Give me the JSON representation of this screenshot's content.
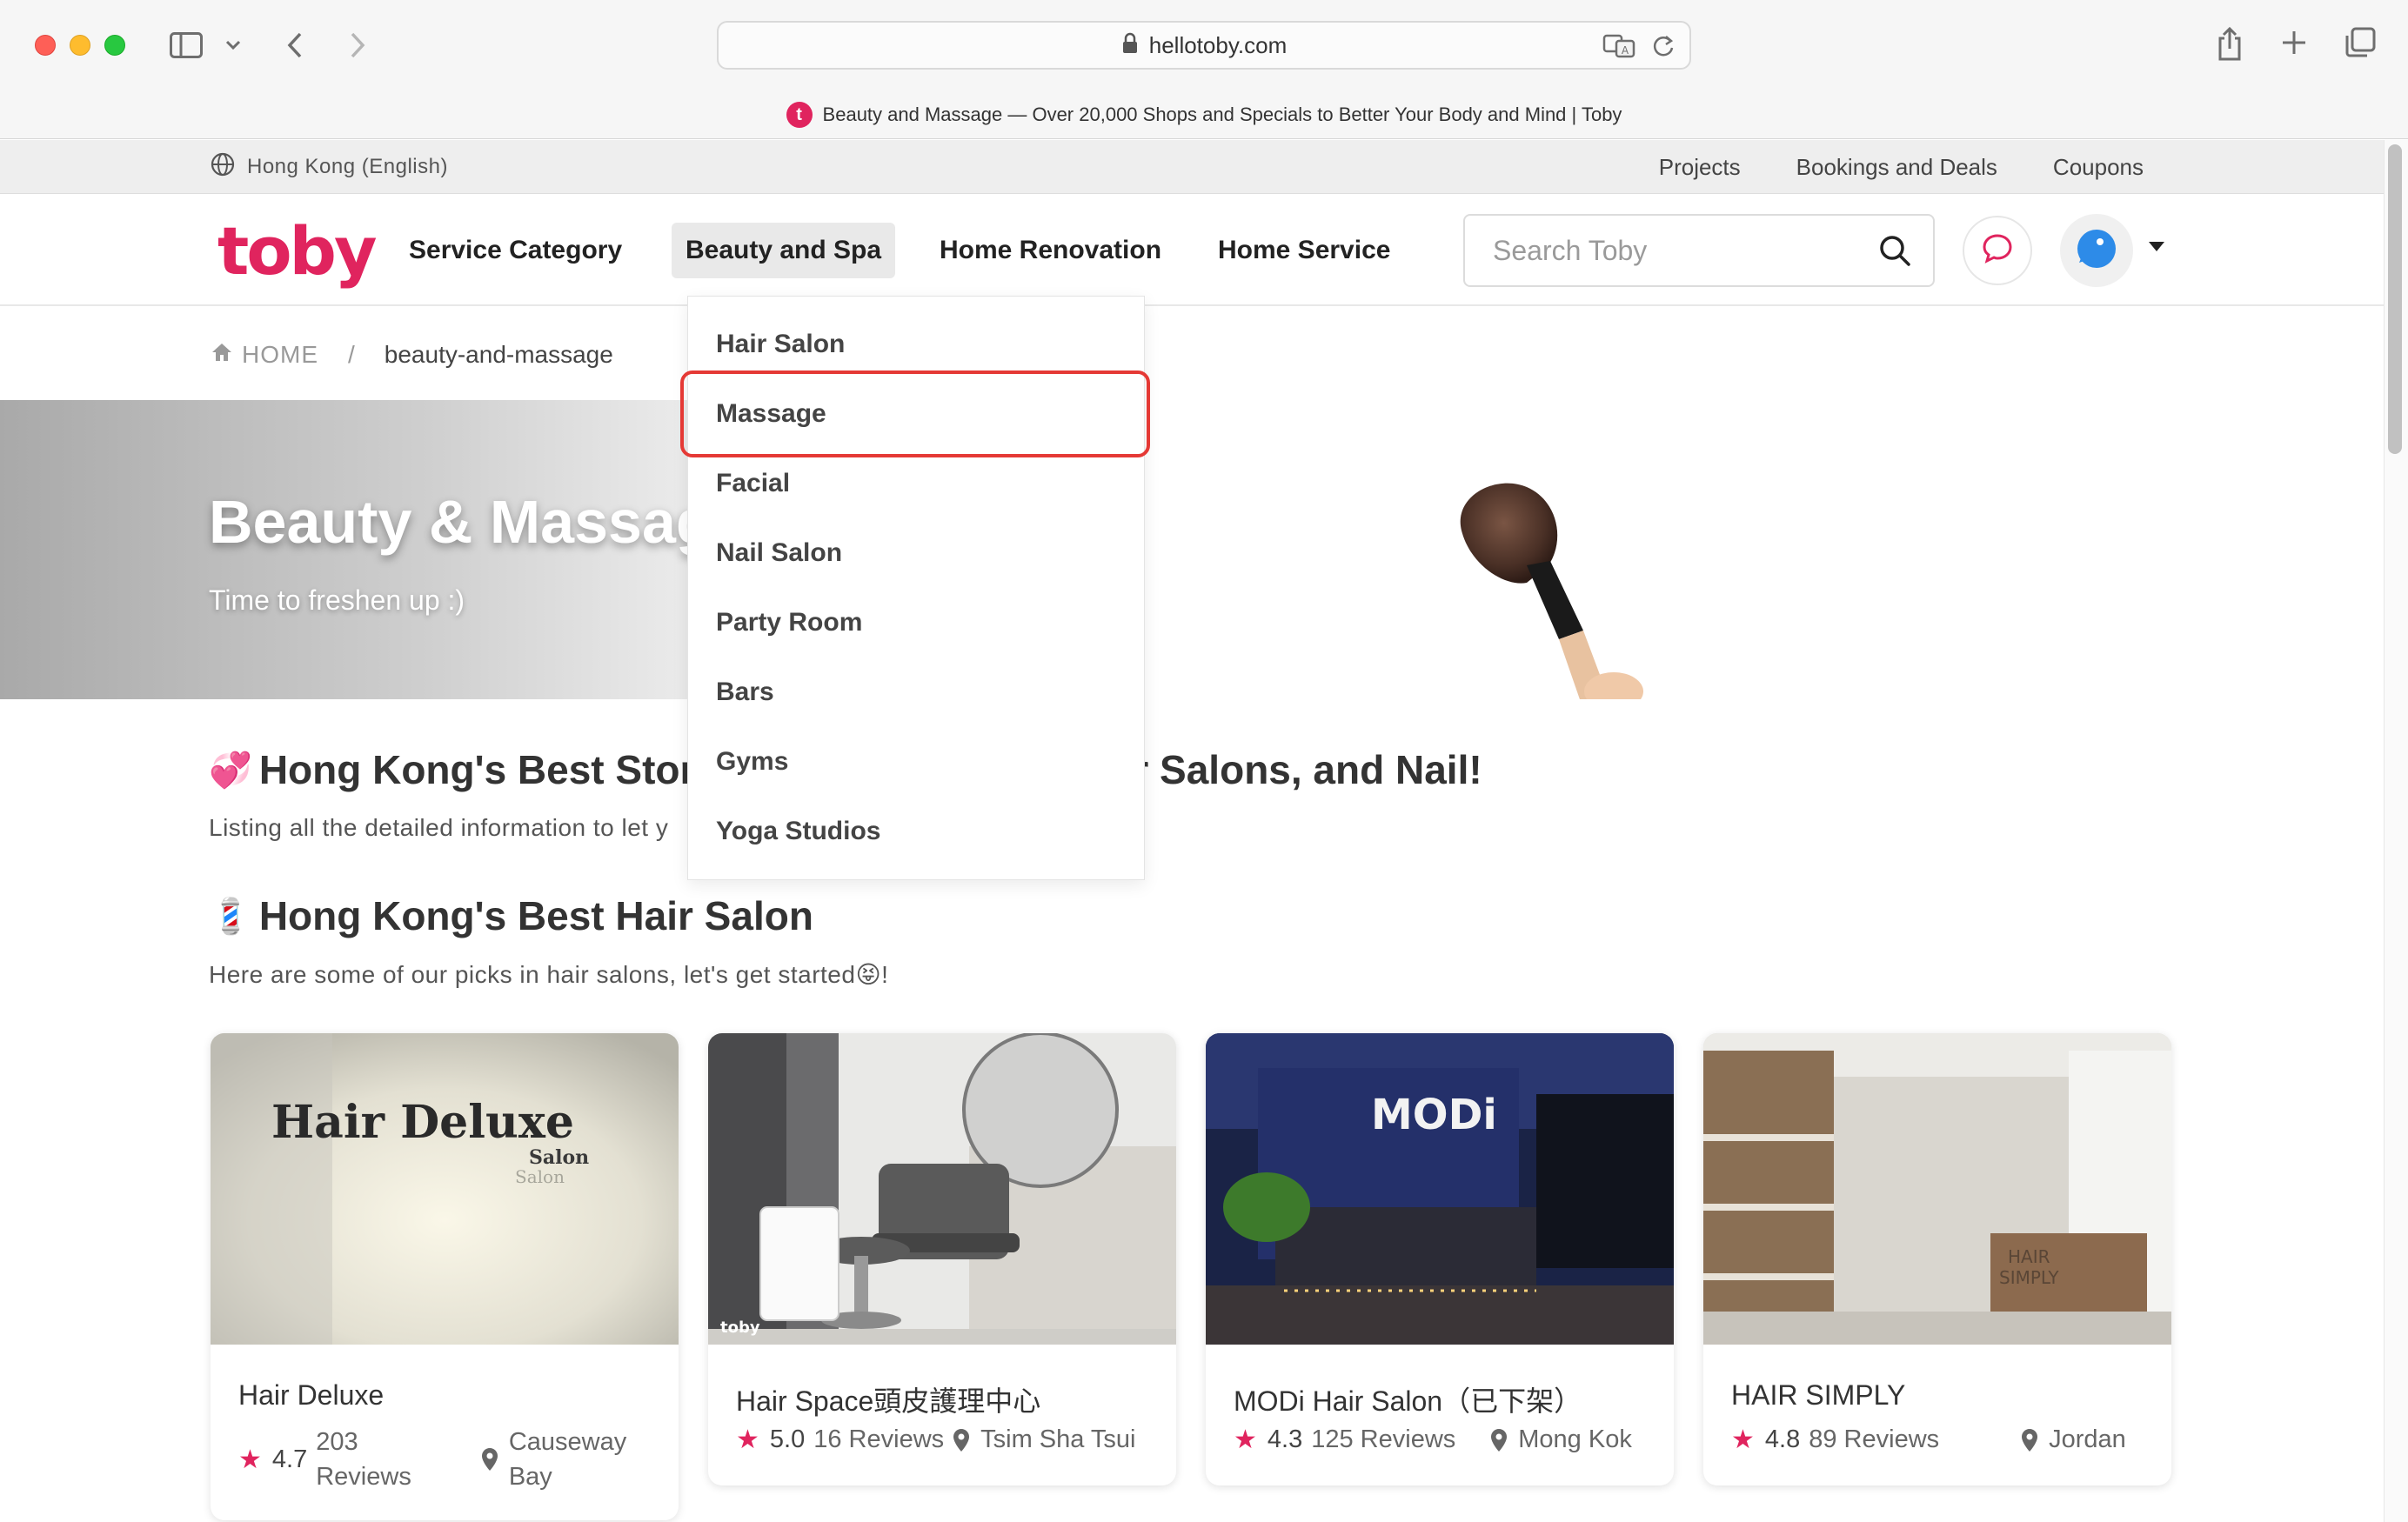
{
  "browser": {
    "url": "hellotoby.com",
    "tab_title": "Beauty and Massage — Over 20,000 Shops and Specials to Better Your Body and Mind | Toby",
    "favicon_letter": "t"
  },
  "utilbar": {
    "region": "Hong Kong (English)",
    "links": [
      "Projects",
      "Bookings and Deals",
      "Coupons"
    ]
  },
  "header": {
    "logo": "toby",
    "nav": [
      "Service Category",
      "Beauty and Spa",
      "Home Renovation",
      "Home Service"
    ],
    "active_nav": "Beauty and Spa",
    "search_placeholder": "Search Toby"
  },
  "breadcrumb": {
    "home": "HOME",
    "separator": "/",
    "current": "beauty-and-massage"
  },
  "hero": {
    "title": "Beauty & Massage",
    "subtitle": "Time to freshen up :)"
  },
  "dropdown": {
    "items": [
      "Hair Salon",
      "Massage",
      "Facial",
      "Nail Salon",
      "Party Room",
      "Bars",
      "Gyms",
      "Yoga Studios"
    ],
    "highlighted": "Massage"
  },
  "sections": {
    "stores": {
      "emoji": "💞",
      "title_left": "Hong Kong's Best Stor",
      "title_right": "air Salons, and Nail!",
      "desc": "Listing all the detailed information to let y"
    },
    "hair": {
      "emoji": "💈",
      "title": "Hong Kong's Best Hair Salon",
      "desc": "Here are some of our picks in hair salons, let's get started😝!"
    }
  },
  "cards": [
    {
      "name": "Hair Deluxe",
      "rating": "4.7",
      "reviews_line1": "203",
      "reviews_line2": "Reviews",
      "location_line1": "Causeway",
      "location_line2": "Bay"
    },
    {
      "name": "Hair Space頭皮護理中心",
      "rating": "5.0",
      "reviews": "16 Reviews",
      "location": "Tsim Sha Tsui"
    },
    {
      "name": "MODi Hair Salon（已下架）",
      "rating": "4.3",
      "reviews": "125 Reviews",
      "location": "Mong Kok"
    },
    {
      "name": "HAIR SIMPLY",
      "rating": "4.8",
      "reviews": "89 Reviews",
      "location": "Jordan"
    }
  ],
  "card_image_text": {
    "deluxe_sign": "Hair Deluxe",
    "deluxe_sub": "Salon",
    "space_watermark": "toby",
    "modi_sign": "MODi",
    "simply_sign_1": "HAIR",
    "simply_sign_2": "SIMPLY"
  },
  "colors": {
    "brand": "#e0245e",
    "highlight_box": "#e53935"
  }
}
